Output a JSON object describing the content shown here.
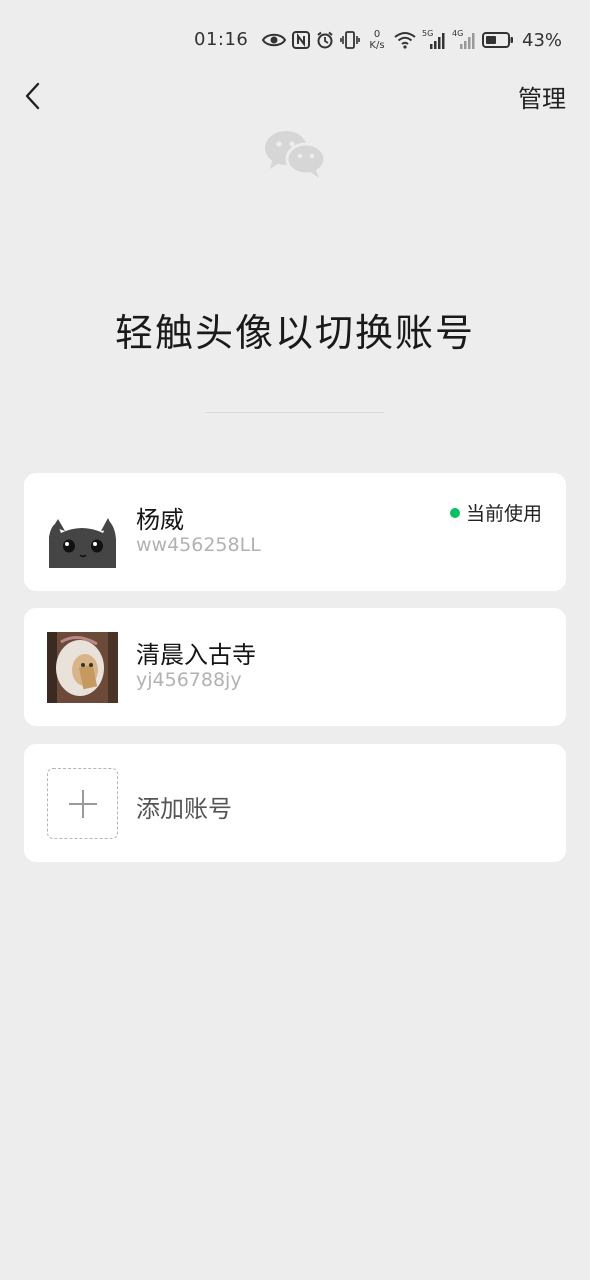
{
  "status_bar": {
    "time": "01:16",
    "speed_value": "0",
    "speed_unit": "K/s",
    "net_5g": "5G",
    "net_4g": "4G",
    "battery": "43%",
    "icons": [
      "eye-icon",
      "nfc-icon",
      "alarm-icon",
      "vibrate-icon",
      "wifi-icon",
      "signal-icon",
      "battery-icon"
    ]
  },
  "nav": {
    "back_icon": "chevron-left-icon",
    "manage_label": "管理"
  },
  "logo_icon": "wechat-logo-icon",
  "title": "轻触头像以切换账号",
  "accounts": [
    {
      "name": "杨威",
      "wxid": "ww456258LL",
      "status": "当前使用",
      "avatar": "cat-avatar"
    },
    {
      "name": "清晨入古寺",
      "wxid": "yj456788jy",
      "avatar": "photo-avatar"
    }
  ],
  "add_account": {
    "label": "添加账号",
    "icon": "plus-icon"
  },
  "colors": {
    "background": "#ededed",
    "card": "#ffffff",
    "status_dot": "#07c160",
    "secondary_text": "#b2b2b2"
  }
}
